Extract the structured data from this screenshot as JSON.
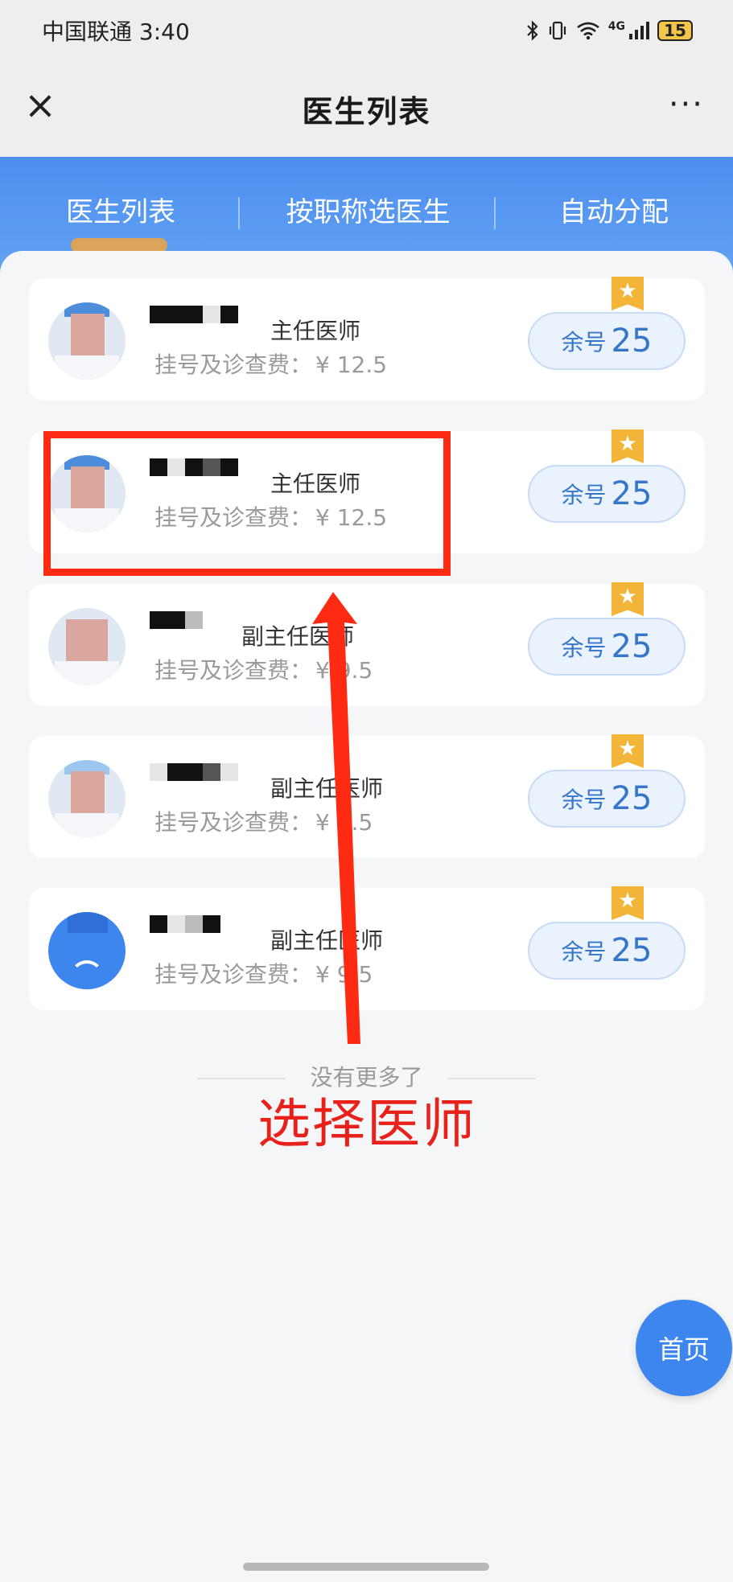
{
  "status_bar": {
    "carrier_time": "中国联通 3:40",
    "icons": [
      "bluetooth-icon",
      "vibrate-icon",
      "wifi-icon",
      "signal-4g-icon"
    ],
    "network": "4G",
    "battery": "15"
  },
  "title_bar": {
    "close_icon": "×",
    "title": "医生列表",
    "more_icon": "···"
  },
  "tabs": [
    {
      "label": "医生列表",
      "active": true
    },
    {
      "label": "按职称选医生",
      "active": false
    },
    {
      "label": "自动分配",
      "active": false
    }
  ],
  "doctors": [
    {
      "title": "主任医师",
      "fee_label": "挂号及诊查费：",
      "fee": "¥ 12.5",
      "remain_label": "余号",
      "remain": "25"
    },
    {
      "title": "主任医师",
      "fee_label": "挂号及诊查费：",
      "fee": "¥ 12.5",
      "remain_label": "余号",
      "remain": "25"
    },
    {
      "title": "副主任医师",
      "fee_label": "挂号及诊查费：",
      "fee": "¥ 9.5",
      "remain_label": "余号",
      "remain": "25"
    },
    {
      "title": "副主任医师",
      "fee_label": "挂号及诊查费：",
      "fee": "¥ 9.5",
      "remain_label": "余号",
      "remain": "25"
    },
    {
      "title": "副主任医师",
      "fee_label": "挂号及诊查费：",
      "fee": "¥ 9.5",
      "remain_label": "余号",
      "remain": "25"
    }
  ],
  "list_end": "没有更多了",
  "annotation": {
    "text": "选择医师",
    "color": "#e8221a"
  },
  "home_button": "首页",
  "colors": {
    "accent": "#4d8ef0",
    "badge": "#f3b538",
    "remain_text": "#3576c9"
  }
}
